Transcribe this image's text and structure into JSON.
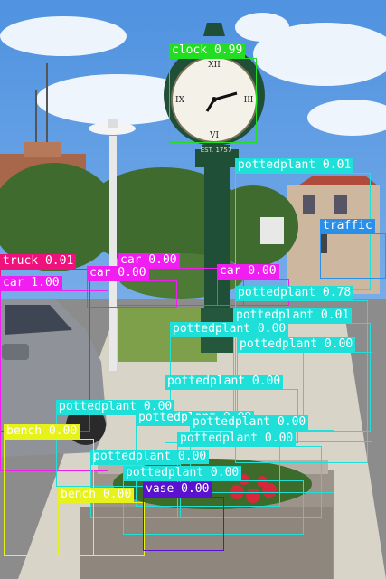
{
  "image": {
    "scene": "street clock with planters under blue sky",
    "clock_dial_text": "EST. 1757",
    "colors": {
      "sky": "#6aa7e6",
      "clock_green": "#1f4f36",
      "dial": "#f4f1e8",
      "trees": "#3f6b2e",
      "road": "#8c8c8c",
      "sidewalk": "#d9d4c8",
      "planter_stone": "#9c948a",
      "car": "#8f9399",
      "flowers": "#d6283a"
    }
  },
  "detections": [
    {
      "label": "clock 0.99",
      "color": "#22dd22",
      "text_color": "#ffffff"
    },
    {
      "label": "pottedplant 0.01",
      "color": "#1fe0d8",
      "text_color": "#ffffff"
    },
    {
      "label": "traffic",
      "color": "#2a8fe8",
      "text_color": "#ffffff"
    },
    {
      "label": "truck 0.01",
      "color": "#f0127c",
      "text_color": "#ffffff"
    },
    {
      "label": "car 0.00",
      "color": "#f01ef0",
      "text_color": "#ffffff"
    },
    {
      "label": "car 0.00",
      "color": "#f01ef0",
      "text_color": "#ffffff"
    },
    {
      "label": "car 0.00",
      "color": "#f01ef0",
      "text_color": "#ffffff"
    },
    {
      "label": "car 1.00",
      "color": "#f01ef0",
      "text_color": "#ffffff"
    },
    {
      "label": "pottedplant 0.78",
      "color": "#1fe0d8",
      "text_color": "#ffffff"
    },
    {
      "label": "pottedplant 0.01",
      "color": "#1fe0d8",
      "text_color": "#ffffff"
    },
    {
      "label": "pottedplant 0.00",
      "color": "#1fe0d8",
      "text_color": "#ffffff"
    },
    {
      "label": "pottedplant 0.00",
      "color": "#1fe0d8",
      "text_color": "#ffffff"
    },
    {
      "label": "pottedplant 0.00",
      "color": "#1fe0d8",
      "text_color": "#ffffff"
    },
    {
      "label": "pottedplant 0.00",
      "color": "#1fe0d8",
      "text_color": "#ffffff"
    },
    {
      "label": "pottedplant 0.00",
      "color": "#1fe0d8",
      "text_color": "#ffffff"
    },
    {
      "label": "pottedplant 0.00",
      "color": "#1fe0d8",
      "text_color": "#ffffff"
    },
    {
      "label": "pottedplant 0.00",
      "color": "#1fe0d8",
      "text_color": "#ffffff"
    },
    {
      "label": "pottedplant 0.00",
      "color": "#1fe0d8",
      "text_color": "#ffffff"
    },
    {
      "label": "pottedplant 0.00",
      "color": "#1fe0d8",
      "text_color": "#ffffff"
    },
    {
      "label": "bench 0.00",
      "color": "#e6f21a",
      "text_color": "#ffffff"
    },
    {
      "label": "bench 0.00",
      "color": "#e6f21a",
      "text_color": "#ffffff"
    },
    {
      "label": "vase 0.00",
      "color": "#5a12d0",
      "text_color": "#ffffff"
    }
  ]
}
